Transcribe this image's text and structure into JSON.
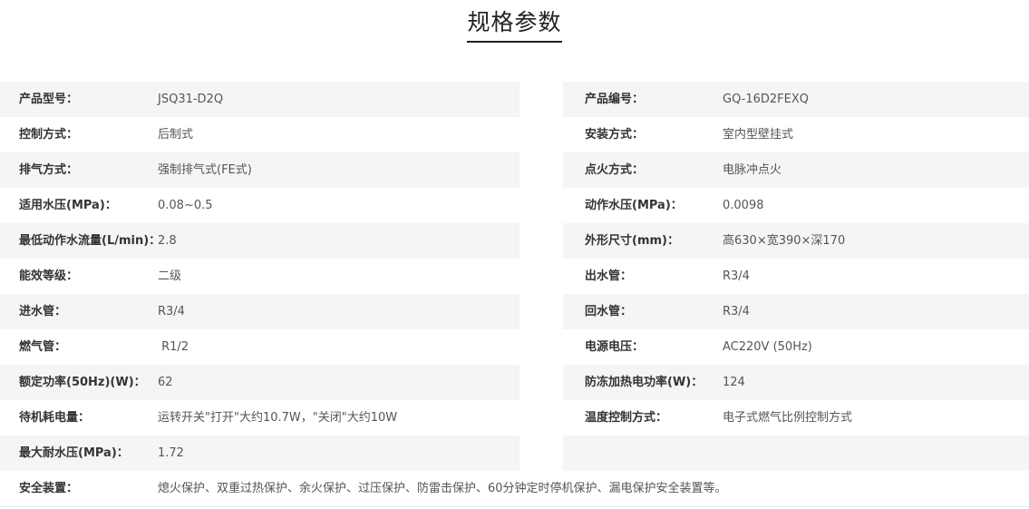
{
  "title": "规格参数",
  "rows": [
    {
      "left": {
        "label": "产品型号：",
        "value": "JSQ31-D2Q"
      },
      "right": {
        "label": "产品编号：",
        "value": "GQ-16D2FEXQ"
      }
    },
    {
      "left": {
        "label": "控制方式：",
        "value": "后制式"
      },
      "right": {
        "label": "安装方式：",
        "value": "室内型壁挂式"
      }
    },
    {
      "left": {
        "label": "排气方式：",
        "value": "强制排气式(FE式)"
      },
      "right": {
        "label": "点火方式：",
        "value": "电脉冲点火"
      }
    },
    {
      "left": {
        "label": "适用水压(MPa)：",
        "value": "0.08~0.5"
      },
      "right": {
        "label": "动作水压(MPa)：",
        "value": "0.0098"
      }
    },
    {
      "left": {
        "label": "最低动作水流量(L/min)：",
        "value": "2.8"
      },
      "right": {
        "label": "外形尺寸(mm)：",
        "value": "高630×宽390×深170"
      }
    },
    {
      "left": {
        "label": "能效等级：",
        "value": "二级"
      },
      "right": {
        "label": "出水管：",
        "value": "R3/4"
      }
    },
    {
      "left": {
        "label": "进水管：",
        "value": "R3/4"
      },
      "right": {
        "label": "回水管：",
        "value": "R3/4"
      }
    },
    {
      "left": {
        "label": "燃气管：",
        "value": " R1/2"
      },
      "right": {
        "label": "电源电压：",
        "value": "AC220V (50Hz)"
      }
    },
    {
      "left": {
        "label": "额定功率(50Hz)(W)：",
        "value": "62"
      },
      "right": {
        "label": "防冻加热电功率(W)：",
        "value": "124"
      }
    },
    {
      "left": {
        "label": "待机耗电量：",
        "value": "运转开关\"打开\"大约10.7W，\"关闭\"大约10W"
      },
      "right": {
        "label": "温度控制方式：",
        "value": "电子式燃气比例控制方式"
      }
    },
    {
      "left": {
        "label": "最大耐水压(MPa)：",
        "value": "1.72"
      },
      "right": {
        "label": "",
        "value": ""
      }
    }
  ],
  "full_row": {
    "label": "安全装置：",
    "value": "熄火保护、双重过热保护、余火保护、过压保护、防雷击保护、60分钟定时停机保护、漏电保护安全装置等。"
  }
}
